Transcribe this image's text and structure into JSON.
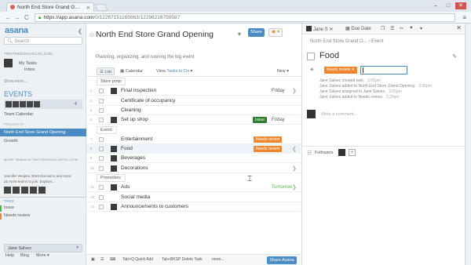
{
  "browser": {
    "tab_title": "North End Store Grand O…",
    "url_host": "https://app.asana.com",
    "url_path": "/0/12267151165663/12296216759587",
    "min": "–",
    "max": "□",
    "close": "✕",
    "back": "←",
    "forward": "→",
    "reload": "C",
    "menu": "≡"
  },
  "sidebar": {
    "logo": "asana",
    "search_placeholder": "Search",
    "workspace": "TWOTREESOLVECOL.COM",
    "my_tasks": "My Tasks",
    "inbox": "Inbox",
    "show_more": "Show more...",
    "events_title": "EVENTS",
    "team_calendar": "Team Calendar",
    "project_label": "PROJECTS",
    "active_project": "North End Store Grand Opening",
    "growth": "Growth",
    "more_teams": "MORE TEAMS IN TWOTREESSOLVECOL.COM",
    "teams_people": "Jennifer Vesipes, Brett Dominino and more",
    "teams_people2": "21 more teams to join. Explore...",
    "tags_title": "TAGS",
    "tags": [
      {
        "label": "Issue",
        "color": "#4caf50"
      },
      {
        "label": "Needs review",
        "color": "#f1852d"
      }
    ],
    "user": "Jane Salvez",
    "footer": [
      "Help",
      "Blog",
      "More ▾"
    ]
  },
  "main": {
    "title": "North End Store Grand Opening",
    "share": "Share",
    "description": "Planning, organizing, and running the big event",
    "views": [
      "List",
      "Calendar"
    ],
    "view_filter": "View",
    "tasks_filter": "Tasks to Do",
    "new_label": "New",
    "rows": [
      {
        "type": "section",
        "name": "Store prep:"
      },
      {
        "type": "task",
        "num": "2",
        "name": "Final inspection",
        "due": "Friday",
        "avatar": true,
        "arrow": true
      },
      {
        "type": "task",
        "num": "3",
        "name": "Certificate of occupancy"
      },
      {
        "type": "task",
        "num": "4",
        "name": "Cleaning"
      },
      {
        "type": "task",
        "num": "5",
        "name": "Set up shop",
        "due": "Friday",
        "avatar": true,
        "tag": "Issue",
        "tag_color": "#2e7d32"
      },
      {
        "type": "section",
        "name": "Event:"
      },
      {
        "type": "task",
        "num": "7",
        "name": "Entertainment",
        "tag": "Needs review",
        "tag_color": "#f1852d"
      },
      {
        "type": "task",
        "num": "8",
        "name": "Food",
        "avatar": true,
        "tag": "Needs review",
        "tag_color": "#f1852d",
        "selected": true,
        "arrow": true
      },
      {
        "type": "task",
        "num": "9",
        "name": "Beverages",
        "avatar": true
      },
      {
        "type": "task",
        "num": "10",
        "name": "Decorations",
        "avatar": true,
        "arrow": true
      },
      {
        "type": "section",
        "name": "Promotion:"
      },
      {
        "type": "task",
        "num": "12",
        "name": "Ads",
        "due": "Tomorrow",
        "due_green": true,
        "avatar": true,
        "arrow": true
      },
      {
        "type": "task",
        "num": "13",
        "name": "Social media"
      },
      {
        "type": "task",
        "num": "14",
        "name": "Announcements to customers",
        "avatar": true
      }
    ],
    "bottom": {
      "quick_add": "Tab+Q Quick Add",
      "delete_task": "Tab+BKSP Delete Task",
      "more": "more...",
      "share": "Share Asana"
    }
  },
  "pane": {
    "assignee": "Jane S",
    "due_date": "Due Date",
    "breadcrumb": "North End Store Grand O...  ›  Event",
    "task_name": "Food",
    "tag": "Needs review",
    "stories": [
      {
        "text": "Jane Salvez created task.",
        "time": "2:05pm"
      },
      {
        "text": "Jane Salvez added to North End Store Grand Opening.",
        "time": "2:05pm"
      },
      {
        "text": "Jane Salvez assigned to Jane Salvez.",
        "time": "2:05pm"
      },
      {
        "text": "Jane Salvez added to Needs review.",
        "time": "2:26pm"
      }
    ],
    "comment_placeholder": "Write a comment...",
    "followers": "Followers"
  }
}
